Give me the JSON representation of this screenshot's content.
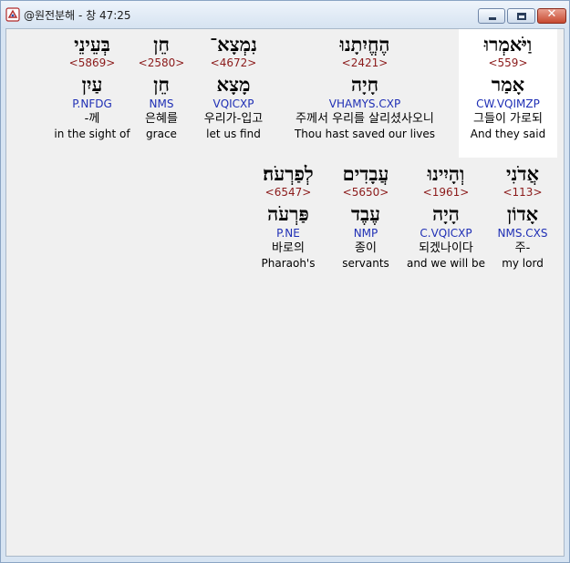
{
  "window": {
    "title": "@원전분해 - 창 47:25",
    "close_glyph": "✕"
  },
  "rows": [
    {
      "words": [
        {
          "heb": "וַיֹּאמְרוּ",
          "strong": "<559>",
          "lemma": "אָמַר",
          "morph": "CW.VQIMZP",
          "kor": "그들이 가로되",
          "eng": "And they said",
          "highlight": true
        },
        {
          "heb": "הֶחֱיִתָנוּ",
          "strong": "<2421>",
          "lemma": "חָיָה",
          "morph": "VHAMYS.CXP",
          "kor": "주께서 우리를 살리셨사오니",
          "eng": "Thou hast saved our lives",
          "highlight": false
        },
        {
          "heb": "נִמְצָא־",
          "strong": "<4672>",
          "lemma": "מָצָא",
          "morph": "VQICXP",
          "kor": "우리가-입고",
          "eng": "let us find",
          "highlight": false
        },
        {
          "heb": "חֵן",
          "strong": "<2580>",
          "lemma": "חֵן",
          "morph": "NMS",
          "kor": "은혜를",
          "eng": "grace",
          "highlight": false
        },
        {
          "heb": "בְּעֵינֵי",
          "strong": "<5869>",
          "lemma": "עַיִן",
          "morph": "P.NFDG",
          "kor": "-께",
          "eng": "in the sight of",
          "highlight": false
        }
      ]
    },
    {
      "words": [
        {
          "heb": "אֲדֹנִי",
          "strong": "<113>",
          "lemma": "אָדוֹן",
          "morph": "NMS.CXS",
          "kor": "주-",
          "eng": "my lord",
          "highlight": false
        },
        {
          "heb": "וְהָיִינוּ",
          "strong": "<1961>",
          "lemma": "הָיָה",
          "morph": "C.VQICXP",
          "kor": "되겠나이다",
          "eng": "and we will be",
          "highlight": false
        },
        {
          "heb": "עֲבָדִים",
          "strong": "<5650>",
          "lemma": "עֶבֶד",
          "morph": "NMP",
          "kor": "종이",
          "eng": "servants",
          "highlight": false
        },
        {
          "heb": "לְפַרְעֹה׃",
          "strong": "<6547>",
          "lemma": "פַּרְעֹה",
          "morph": "P.NE",
          "kor": "바로의",
          "eng": "Pharaoh's",
          "highlight": false
        }
      ]
    }
  ]
}
